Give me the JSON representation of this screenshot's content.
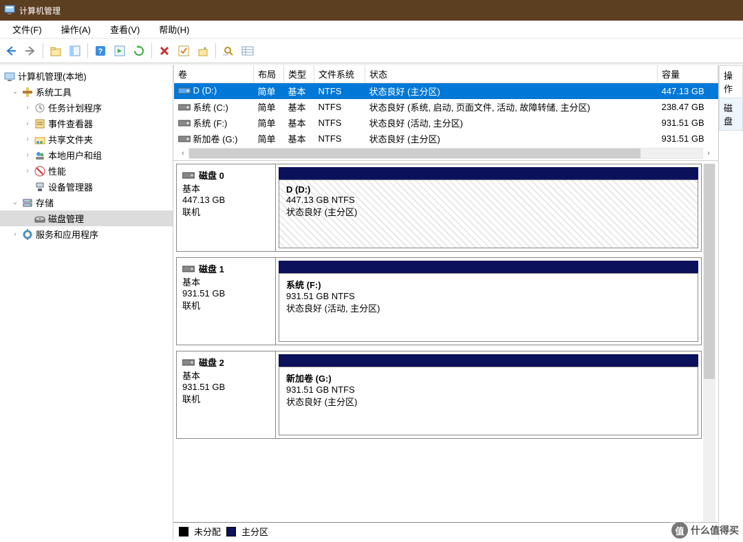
{
  "window": {
    "title": "计算机管理"
  },
  "menu": {
    "file": "文件(F)",
    "action": "操作(A)",
    "view": "查看(V)",
    "help": "帮助(H)"
  },
  "tree": {
    "root": "计算机管理(本地)",
    "systools": "系统工具",
    "task": "任务计划程序",
    "event": "事件查看器",
    "shared": "共享文件夹",
    "users": "本地用户和组",
    "perf": "性能",
    "devmgr": "设备管理器",
    "storage": "存储",
    "diskmgmt": "磁盘管理",
    "services": "服务和应用程序"
  },
  "columns": {
    "vol": "卷",
    "layout": "布局",
    "type": "类型",
    "fs": "文件系统",
    "status": "状态",
    "cap": "容量"
  },
  "volumes": [
    {
      "name": "D (D:)",
      "layout": "简单",
      "type": "基本",
      "fs": "NTFS",
      "status": "状态良好 (主分区)",
      "cap": "447.13 GB",
      "sel": true
    },
    {
      "name": "系统 (C:)",
      "layout": "简单",
      "type": "基本",
      "fs": "NTFS",
      "status": "状态良好 (系统, 启动, 页面文件, 活动, 故障转储, 主分区)",
      "cap": "238.47 GB"
    },
    {
      "name": "系统 (F:)",
      "layout": "简单",
      "type": "基本",
      "fs": "NTFS",
      "status": "状态良好 (活动, 主分区)",
      "cap": "931.51 GB"
    },
    {
      "name": "新加卷 (G:)",
      "layout": "简单",
      "type": "基本",
      "fs": "NTFS",
      "status": "状态良好 (主分区)",
      "cap": "931.51 GB"
    }
  ],
  "disks": [
    {
      "name": "磁盘 0",
      "typeline": "基本",
      "size": "447.13 GB",
      "online": "联机",
      "part": {
        "title": "D  (D:)",
        "line2": "447.13 GB NTFS",
        "line3": "状态良好 (主分区)",
        "hatched": true
      }
    },
    {
      "name": "磁盘 1",
      "typeline": "基本",
      "size": "931.51 GB",
      "online": "联机",
      "part": {
        "title": "系统  (F:)",
        "line2": "931.51 GB NTFS",
        "line3": "状态良好 (活动, 主分区)"
      }
    },
    {
      "name": "磁盘 2",
      "typeline": "基本",
      "size": "931.51 GB",
      "online": "联机",
      "part": {
        "title": "新加卷  (G:)",
        "line2": "931.51 GB NTFS",
        "line3": "状态良好 (主分区)"
      }
    }
  ],
  "legend": {
    "unalloc": "未分配",
    "primary": "主分区"
  },
  "rightpanel": {
    "header": "操作",
    "item": "磁盘"
  },
  "watermark": {
    "text": "什么值得买",
    "badge": "值"
  }
}
